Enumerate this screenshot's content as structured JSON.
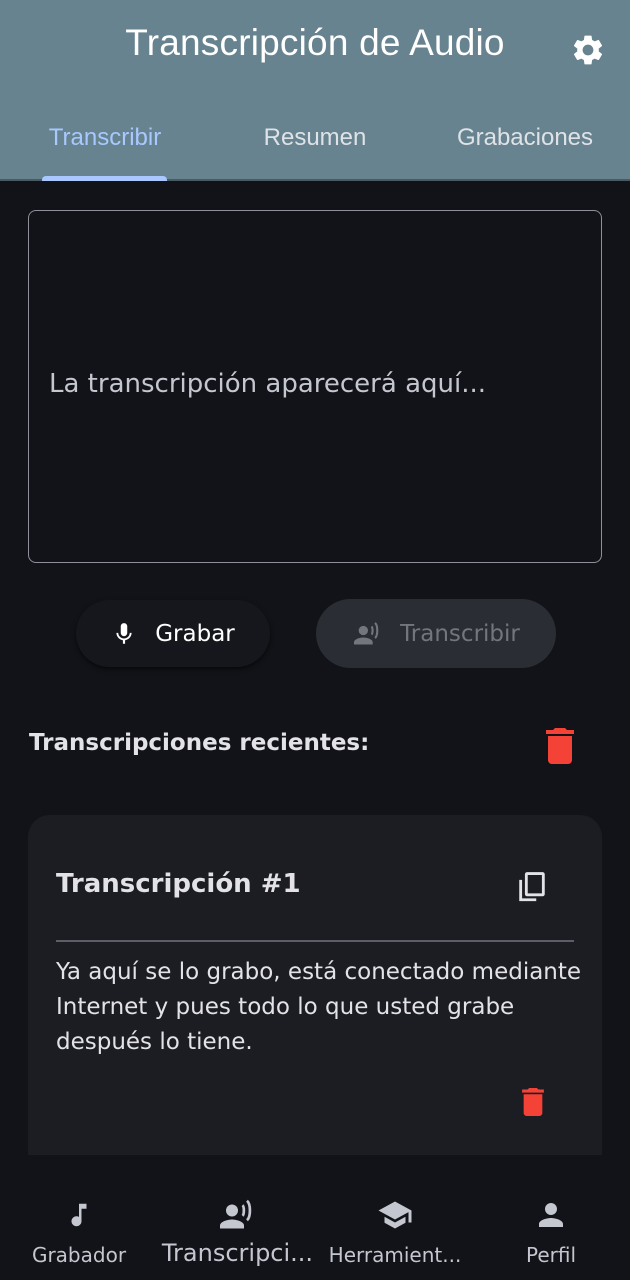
{
  "app": {
    "title": "Transcripción de Audio"
  },
  "icons": {
    "settings": "gear-icon",
    "record": "microphone-icon",
    "transcribe": "voice-person-icon",
    "delete_all": "trash-icon",
    "copy": "copy-icon",
    "delete_item": "trash-icon"
  },
  "colors": {
    "appbar": "#66838f",
    "accent": "#a8c8ff",
    "danger": "#f44336",
    "background": "#111318",
    "card": "#1b1d23"
  },
  "tabs": [
    {
      "label": "Transcribir",
      "active": true
    },
    {
      "label": "Resumen",
      "active": false
    },
    {
      "label": "Grabaciones",
      "active": false
    }
  ],
  "transcript": {
    "placeholder": "La transcripción aparecerá aquí..."
  },
  "actions": {
    "record_label": "Grabar",
    "transcribe_label": "Transcribir"
  },
  "recent": {
    "heading": "Transcripciones recientes:",
    "items": [
      {
        "title": "Transcripción #1",
        "text": "Ya aquí se lo grabo, está conectado mediante Internet y pues todo lo que usted grabe después lo tiene."
      }
    ]
  },
  "bottom_nav": {
    "items": [
      {
        "label": "Grabador",
        "icon": "music-note-icon"
      },
      {
        "label": "Transcripci...",
        "icon": "voice-person-icon",
        "active": true
      },
      {
        "label": "Herramient...",
        "icon": "graduation-cap-icon"
      },
      {
        "label": "Perfil",
        "icon": "person-icon"
      }
    ]
  }
}
